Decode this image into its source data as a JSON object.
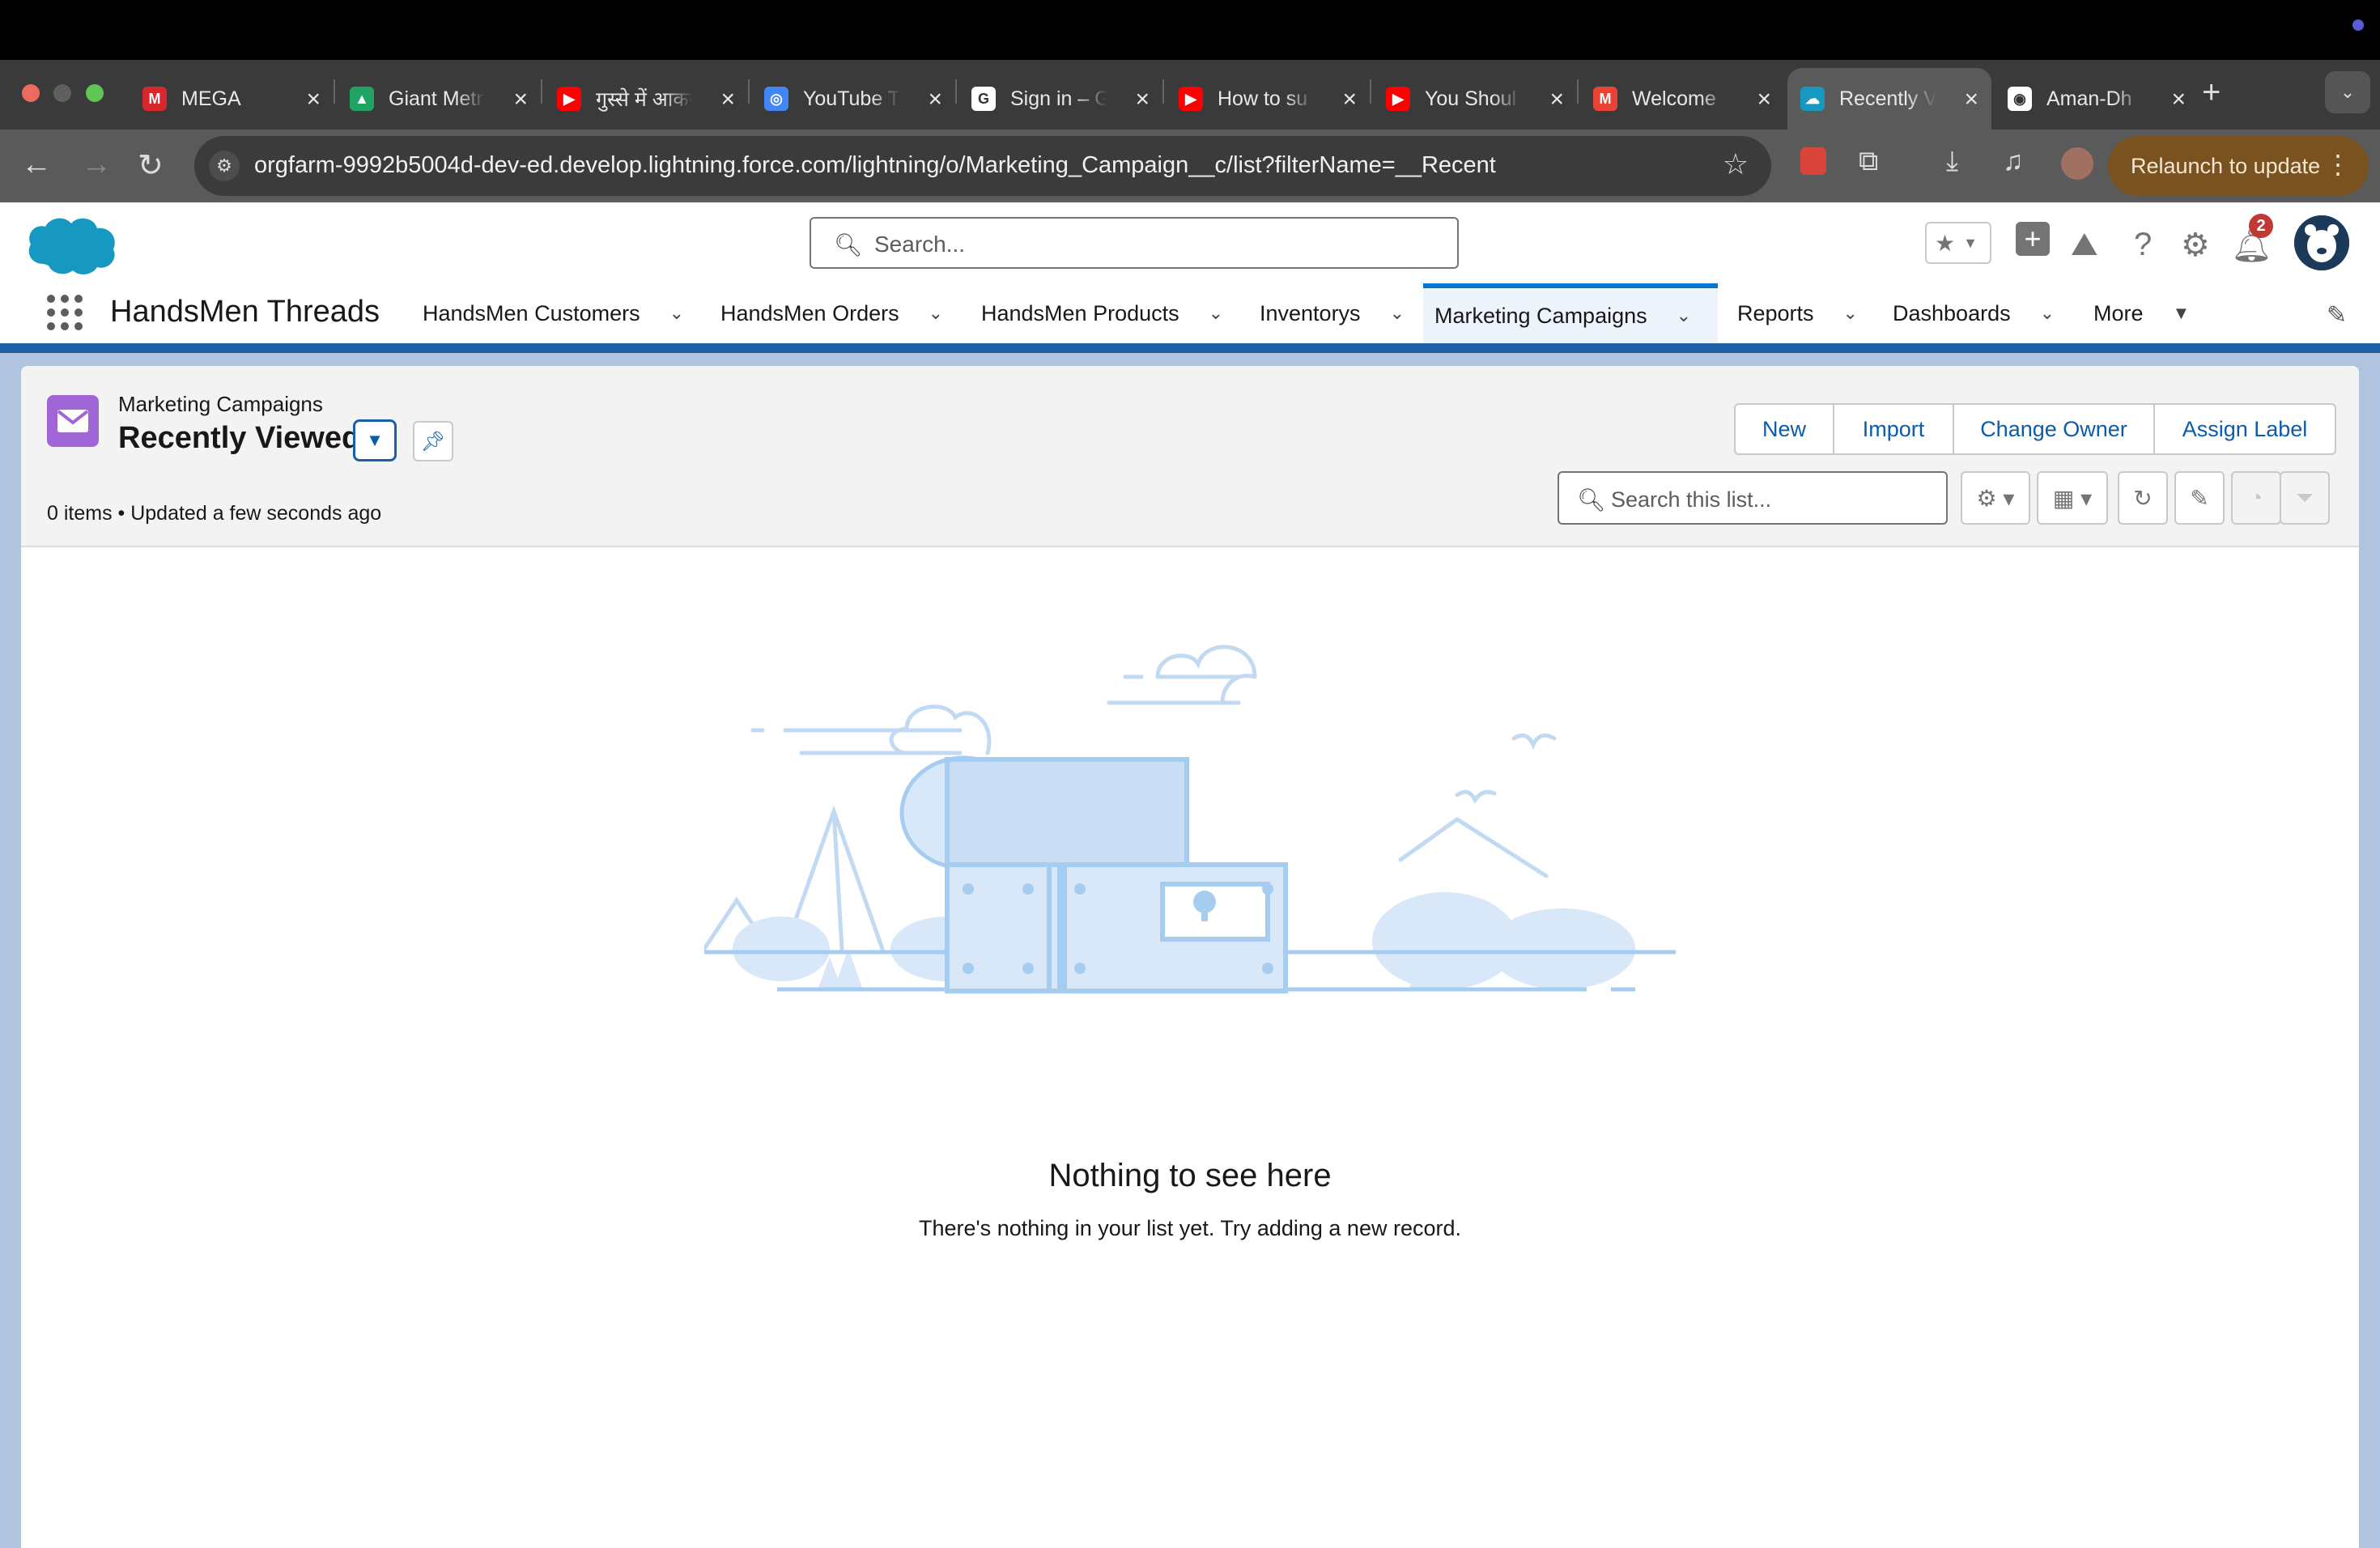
{
  "browser": {
    "tabs": [
      {
        "title": "MEGA",
        "icon": "mega-icon",
        "color": "#d9272e",
        "glyph": "M"
      },
      {
        "title": "Giant Metr",
        "icon": "google-drive-icon",
        "color": "#1fa463",
        "glyph": "▲"
      },
      {
        "title": "गुस्से में आकर",
        "icon": "youtube-icon",
        "color": "#ff0000",
        "glyph": "▶"
      },
      {
        "title": "YouTube T",
        "icon": "google-lens-icon",
        "color": "#4285f4",
        "glyph": "◎"
      },
      {
        "title": "Sign in – G",
        "icon": "google-icon",
        "color": "#ffffff",
        "glyph": "G"
      },
      {
        "title": "How to su",
        "icon": "youtube-icon",
        "color": "#ff0000",
        "glyph": "▶"
      },
      {
        "title": "You Shoul",
        "icon": "youtube-icon",
        "color": "#ff0000",
        "glyph": "▶"
      },
      {
        "title": "Welcome",
        "icon": "gmail-icon",
        "color": "#ea4335",
        "glyph": "M"
      },
      {
        "title": "Recently V",
        "icon": "salesforce-icon",
        "color": "#1798c1",
        "glyph": "☁",
        "active": true
      },
      {
        "title": "Aman-Dh",
        "icon": "github-icon",
        "color": "#ffffff",
        "glyph": "◉"
      }
    ],
    "new_tab": "+",
    "url": "orgfarm-9992b5004d-dev-ed.develop.lightning.force.com/lightning/o/Marketing_Campaign__c/list?filterName=__Recent",
    "relaunch_label": "Relaunch to update"
  },
  "header": {
    "search_placeholder": "Search...",
    "notification_count": "2",
    "app_name": "HandsMen Threads",
    "nav": [
      {
        "label": "HandsMen Customers"
      },
      {
        "label": "HandsMen Orders"
      },
      {
        "label": "HandsMen Products"
      },
      {
        "label": "Inventorys"
      },
      {
        "label": "Marketing Campaigns",
        "active": true
      },
      {
        "label": "Reports"
      },
      {
        "label": "Dashboards"
      },
      {
        "label": "More"
      }
    ]
  },
  "list": {
    "object_label": "Marketing Campaigns",
    "view_name": "Recently Viewed",
    "meta": "0 items • Updated a few seconds ago",
    "actions": [
      "New",
      "Import",
      "Change Owner",
      "Assign Label"
    ],
    "search_placeholder": "Search this list...",
    "empty_title": "Nothing to see here",
    "empty_text": "There's nothing in your list yet. Try adding a new record."
  },
  "colors": {
    "brand": "#0176d3",
    "object_icon": "#a066d6"
  }
}
